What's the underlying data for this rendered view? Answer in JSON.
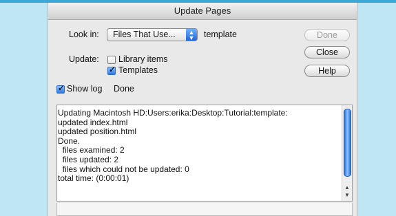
{
  "window": {
    "title": "Update Pages"
  },
  "look_in": {
    "label": "Look in:",
    "selected": "Files That Use...",
    "value": "template"
  },
  "update": {
    "label": "Update:",
    "library_items": {
      "label": "Library items",
      "checked": false
    },
    "templates": {
      "label": "Templates",
      "checked": true
    }
  },
  "show_log": {
    "label": "Show log",
    "checked": true,
    "status": "Done"
  },
  "buttons": {
    "done": "Done",
    "close": "Close",
    "help": "Help"
  },
  "log": {
    "lines": [
      "Updating Macintosh HD:Users:erika:Desktop:Tutorial:template:",
      "updated index.html",
      "updated position.html",
      "Done.",
      "  files examined: 2",
      "  files updated: 2",
      "  files which could not be updated: 0",
      "total time: (0:00:01)"
    ]
  },
  "icons": {
    "popup_arrows": "updown-arrows-icon",
    "scroll_up": "scroll-up-arrow-icon",
    "scroll_down": "scroll-down-arrow-icon",
    "checkmark": "checkmark-icon"
  },
  "colors": {
    "accent_blue": "#2a78e3",
    "background": "#bfe6f3",
    "dialog": "#e9e9e9"
  }
}
